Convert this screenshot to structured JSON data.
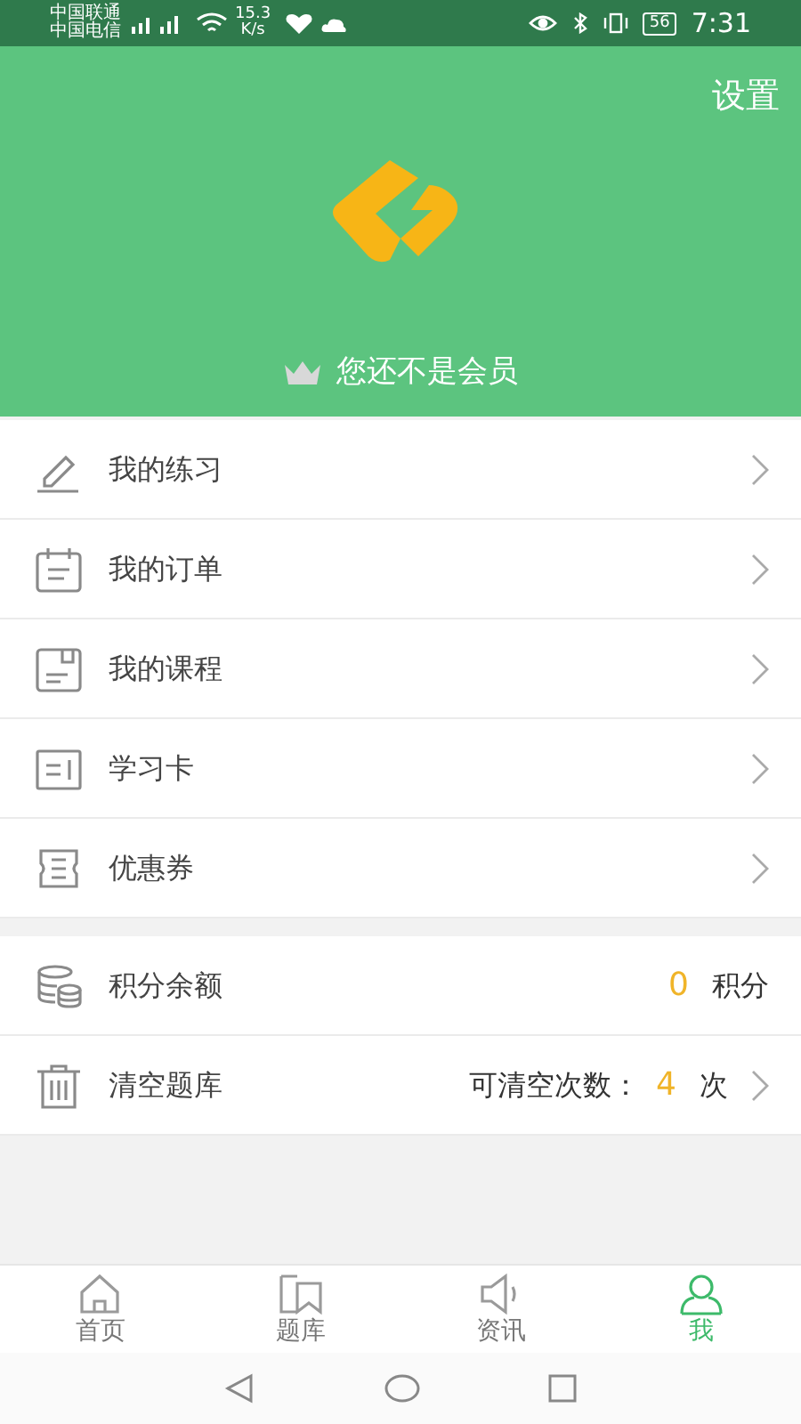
{
  "status_bar": {
    "carriers": [
      "中国联通",
      "中国电信"
    ],
    "speed": [
      "15.3",
      "K/s"
    ],
    "battery": "56",
    "time": "7:31"
  },
  "header": {
    "settings": "设置",
    "membership": "您还不是会员"
  },
  "menu": [
    {
      "kind": "pencil",
      "label": "我的练习"
    },
    {
      "kind": "calendar",
      "label": "我的订单"
    },
    {
      "kind": "folder",
      "label": "我的课程"
    },
    {
      "kind": "card",
      "label": "学习卡"
    },
    {
      "kind": "ticket",
      "label": "优惠券"
    }
  ],
  "account": [
    {
      "kind": "coins",
      "label": "积分余额",
      "value": "0",
      "suffix": "积分",
      "chevron": false
    },
    {
      "kind": "trash",
      "label": "清空题库",
      "prefix": "可清空次数：",
      "value": "4",
      "suffix": "次",
      "chevron": true
    }
  ],
  "tabs": [
    {
      "kind": "home",
      "label": "首页",
      "selected": false
    },
    {
      "kind": "book",
      "label": "题库",
      "selected": false
    },
    {
      "kind": "speaker",
      "label": "资讯",
      "selected": false
    },
    {
      "kind": "person",
      "label": "我",
      "selected": true
    }
  ]
}
